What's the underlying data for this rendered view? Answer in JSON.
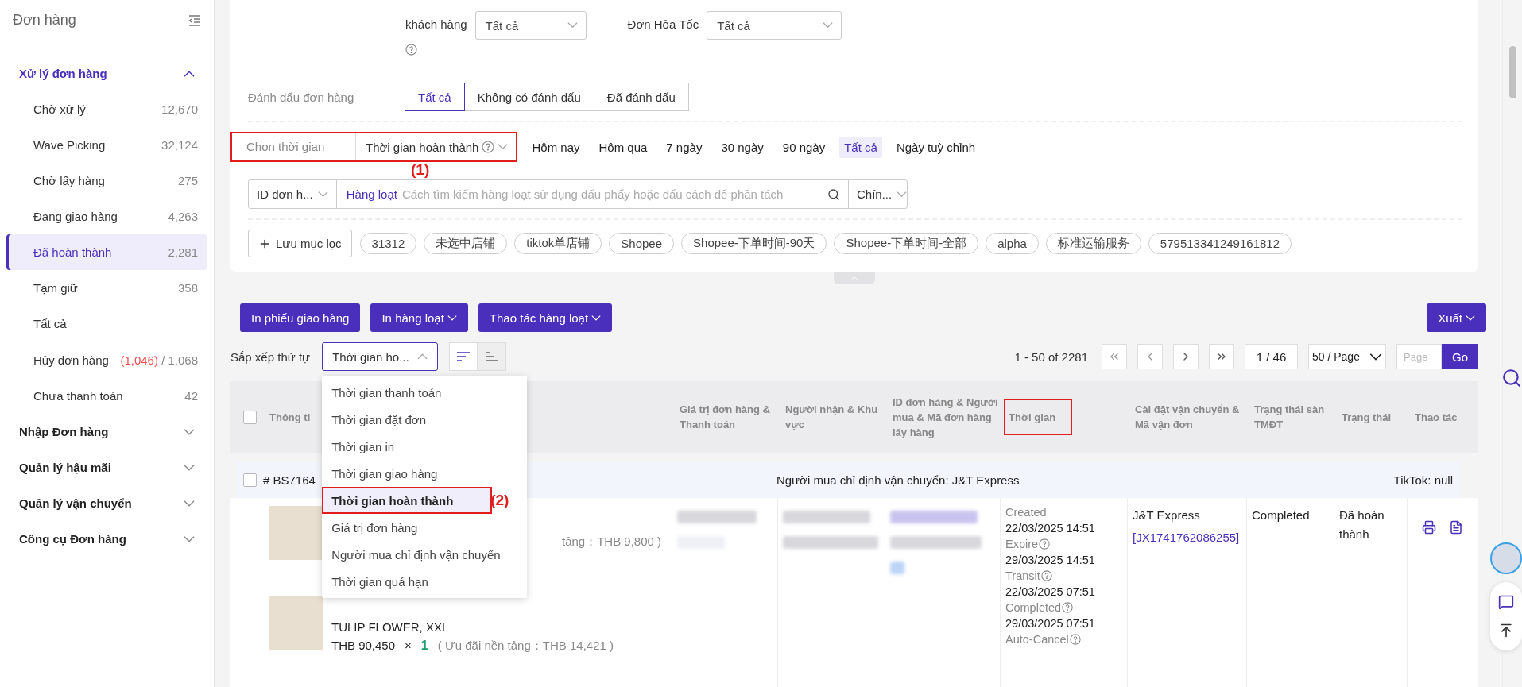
{
  "sidebar": {
    "title": "Đơn hàng",
    "groups": [
      {
        "label": "Xử lý đơn hàng",
        "expanded": true,
        "items": [
          {
            "label": "Chờ xử lý",
            "count": "12,670",
            "selected": false
          },
          {
            "label": "Wave Picking",
            "count": "32,124",
            "selected": false
          },
          {
            "label": "Chờ lấy hàng",
            "count": "275",
            "selected": false
          },
          {
            "label": "Đang giao hàng",
            "count": "4,263",
            "selected": false
          },
          {
            "label": "Đã hoàn thành",
            "count": "2,281",
            "selected": true
          },
          {
            "label": "Tạm giữ",
            "count": "358",
            "selected": false
          },
          {
            "label": "Tất cả",
            "selected": false
          },
          {
            "label": "Hủy đơn hàng",
            "alert_count": "(1,046)",
            "count": "/ 1,068",
            "selected": false,
            "divider_before": true
          },
          {
            "label": "Chưa thanh toán",
            "count": "42",
            "selected": false
          }
        ]
      },
      {
        "label": "Nhập Đơn hàng",
        "expanded": false
      },
      {
        "label": "Quản lý hậu mãi",
        "expanded": false
      },
      {
        "label": "Quản lý vận chuyển",
        "expanded": false
      },
      {
        "label": "Công cụ Đơn hàng",
        "expanded": false
      }
    ]
  },
  "filters": {
    "customer_level": {
      "label": "khách hàng",
      "value": "Tất cả"
    },
    "express": {
      "label": "Đơn Hỏa Tốc",
      "value": "Tất cả"
    },
    "mark": {
      "label": "Đánh dấu đơn hàng",
      "options": [
        {
          "label": "Tất cả",
          "selected": true
        },
        {
          "label": "Không có đánh dấu",
          "selected": false
        },
        {
          "label": "Đã đánh dấu",
          "selected": false
        }
      ]
    },
    "time": {
      "label": "Chọn thời gian",
      "type": "Thời gian hoàn thành",
      "annotation": "(1)",
      "quick": [
        {
          "label": "Hôm nay",
          "selected": false
        },
        {
          "label": "Hôm qua",
          "selected": false
        },
        {
          "label": "7 ngày",
          "selected": false
        },
        {
          "label": "30 ngày",
          "selected": false
        },
        {
          "label": "90 ngày",
          "selected": false
        },
        {
          "label": "Tất cả",
          "selected": true
        },
        {
          "label": "Ngày tuỳ chỉnh",
          "selected": false
        }
      ]
    },
    "search": {
      "field": "ID đơn h...",
      "mode": "Hàng loạt",
      "placeholder": "Cách tìm kiếm hàng loạt sử dụng dấu phẩy hoặc dấu cách để phân tách",
      "match": "Chín..."
    },
    "saved": {
      "button": "Lưu mục lọc",
      "tags": [
        "31312",
        "未选中店铺",
        "tiktok单店铺",
        "Shopee",
        "Shopee-下单时间-90天",
        "Shopee-下单时间-全部",
        "alpha",
        "标准运输服务",
        "579513341249161812"
      ]
    }
  },
  "toolbar": {
    "buttons": [
      {
        "label": "In phiếu giao hàng",
        "caret": false
      },
      {
        "label": "In hàng loạt",
        "caret": true
      },
      {
        "label": "Thao tác hàng loạt",
        "caret": true
      }
    ],
    "export": "Xuất"
  },
  "sort": {
    "label": "Sắp xếp thứ tự",
    "value": "Thời gian ho...",
    "annotation": "(2)",
    "options": [
      {
        "label": "Thời gian thanh toán",
        "selected": false
      },
      {
        "label": "Thời gian đặt đơn",
        "selected": false
      },
      {
        "label": "Thời gian in",
        "selected": false
      },
      {
        "label": "Thời gian giao hàng",
        "selected": false
      },
      {
        "label": "Thời gian hoàn thành",
        "selected": true
      },
      {
        "label": "Giá trị đơn hàng",
        "selected": false
      },
      {
        "label": "Người mua chỉ định vận chuyển",
        "selected": false
      },
      {
        "label": "Thời gian quá hạn",
        "selected": false
      }
    ]
  },
  "pagination": {
    "range": "1 - 50 of 2281",
    "page": "1 / 46",
    "page_size": "50 / Page",
    "jump_placeholder": "Page",
    "go": "Go"
  },
  "table": {
    "columns": [
      {
        "label": "Thông ti",
        "highlighted": false
      },
      {
        "label": "Giá trị đơn hàng & Thanh toán",
        "highlighted": false
      },
      {
        "label": "Người nhận & Khu vực",
        "highlighted": false
      },
      {
        "label": "ID đơn hàng & Người mua & Mã đơn hàng lấy hàng",
        "highlighted": false
      },
      {
        "label": "Thời gian",
        "highlighted": true
      },
      {
        "label": "Cài đặt vận chuyển & Mã vận đơn",
        "highlighted": false
      },
      {
        "label": "Trạng thái sàn TMĐT",
        "highlighted": false
      },
      {
        "label": "Trạng thái",
        "highlighted": false
      },
      {
        "label": "Thao tác",
        "highlighted": false
      }
    ],
    "header_checkbox": {
      "checked": false
    },
    "group": {
      "checked": false,
      "order": "# BS7164",
      "shipping": "Người mua chỉ định vận chuyển: J&T Express",
      "platform": "TikTok: null"
    },
    "row": {
      "products": [
        {
          "price_line": "tảng：THB 9,800 )"
        },
        {
          "lines": [
            "TULIP FLOWER, XXL"
          ],
          "price": "THB 90,450",
          "times": "×",
          "qty": "1",
          "discount": "( Ưu đãi nền tảng：THB 14,421 )"
        }
      ],
      "times": [
        {
          "label": "Created",
          "help": false,
          "value": "22/03/2025 14:51"
        },
        {
          "label": "Expire",
          "help": true,
          "value": "29/03/2025 14:51"
        },
        {
          "label": "Transit",
          "help": true,
          "value": "22/03/2025 07:51"
        },
        {
          "label": "Completed",
          "help": true,
          "value": "29/03/2025 07:51"
        },
        {
          "label": "Auto-Cancel",
          "help": true
        }
      ],
      "carrier": "J&T Express",
      "tracking": "[JX1741762086255]",
      "platform_status": "Completed",
      "status": "Đã hoàn thành"
    }
  }
}
